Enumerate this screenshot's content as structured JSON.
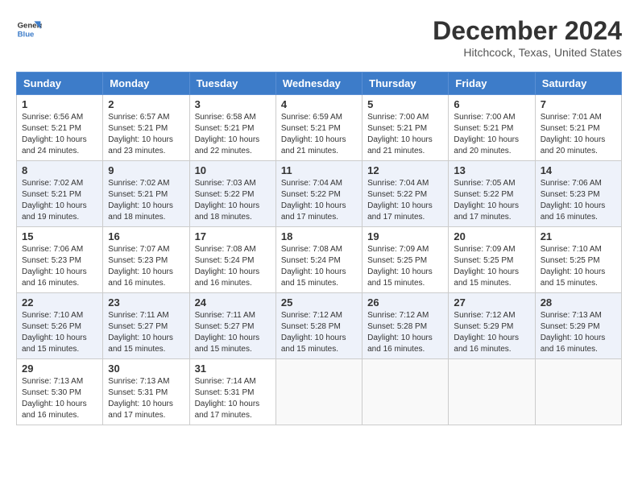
{
  "header": {
    "logo_line1": "General",
    "logo_line2": "Blue",
    "month": "December 2024",
    "location": "Hitchcock, Texas, United States"
  },
  "days_of_week": [
    "Sunday",
    "Monday",
    "Tuesday",
    "Wednesday",
    "Thursday",
    "Friday",
    "Saturday"
  ],
  "weeks": [
    [
      {
        "day": "1",
        "sunrise": "6:56 AM",
        "sunset": "5:21 PM",
        "daylight": "10 hours and 24 minutes."
      },
      {
        "day": "2",
        "sunrise": "6:57 AM",
        "sunset": "5:21 PM",
        "daylight": "10 hours and 23 minutes."
      },
      {
        "day": "3",
        "sunrise": "6:58 AM",
        "sunset": "5:21 PM",
        "daylight": "10 hours and 22 minutes."
      },
      {
        "day": "4",
        "sunrise": "6:59 AM",
        "sunset": "5:21 PM",
        "daylight": "10 hours and 21 minutes."
      },
      {
        "day": "5",
        "sunrise": "7:00 AM",
        "sunset": "5:21 PM",
        "daylight": "10 hours and 21 minutes."
      },
      {
        "day": "6",
        "sunrise": "7:00 AM",
        "sunset": "5:21 PM",
        "daylight": "10 hours and 20 minutes."
      },
      {
        "day": "7",
        "sunrise": "7:01 AM",
        "sunset": "5:21 PM",
        "daylight": "10 hours and 20 minutes."
      }
    ],
    [
      {
        "day": "8",
        "sunrise": "7:02 AM",
        "sunset": "5:21 PM",
        "daylight": "10 hours and 19 minutes."
      },
      {
        "day": "9",
        "sunrise": "7:02 AM",
        "sunset": "5:21 PM",
        "daylight": "10 hours and 18 minutes."
      },
      {
        "day": "10",
        "sunrise": "7:03 AM",
        "sunset": "5:22 PM",
        "daylight": "10 hours and 18 minutes."
      },
      {
        "day": "11",
        "sunrise": "7:04 AM",
        "sunset": "5:22 PM",
        "daylight": "10 hours and 17 minutes."
      },
      {
        "day": "12",
        "sunrise": "7:04 AM",
        "sunset": "5:22 PM",
        "daylight": "10 hours and 17 minutes."
      },
      {
        "day": "13",
        "sunrise": "7:05 AM",
        "sunset": "5:22 PM",
        "daylight": "10 hours and 17 minutes."
      },
      {
        "day": "14",
        "sunrise": "7:06 AM",
        "sunset": "5:23 PM",
        "daylight": "10 hours and 16 minutes."
      }
    ],
    [
      {
        "day": "15",
        "sunrise": "7:06 AM",
        "sunset": "5:23 PM",
        "daylight": "10 hours and 16 minutes."
      },
      {
        "day": "16",
        "sunrise": "7:07 AM",
        "sunset": "5:23 PM",
        "daylight": "10 hours and 16 minutes."
      },
      {
        "day": "17",
        "sunrise": "7:08 AM",
        "sunset": "5:24 PM",
        "daylight": "10 hours and 16 minutes."
      },
      {
        "day": "18",
        "sunrise": "7:08 AM",
        "sunset": "5:24 PM",
        "daylight": "10 hours and 15 minutes."
      },
      {
        "day": "19",
        "sunrise": "7:09 AM",
        "sunset": "5:25 PM",
        "daylight": "10 hours and 15 minutes."
      },
      {
        "day": "20",
        "sunrise": "7:09 AM",
        "sunset": "5:25 PM",
        "daylight": "10 hours and 15 minutes."
      },
      {
        "day": "21",
        "sunrise": "7:10 AM",
        "sunset": "5:25 PM",
        "daylight": "10 hours and 15 minutes."
      }
    ],
    [
      {
        "day": "22",
        "sunrise": "7:10 AM",
        "sunset": "5:26 PM",
        "daylight": "10 hours and 15 minutes."
      },
      {
        "day": "23",
        "sunrise": "7:11 AM",
        "sunset": "5:27 PM",
        "daylight": "10 hours and 15 minutes."
      },
      {
        "day": "24",
        "sunrise": "7:11 AM",
        "sunset": "5:27 PM",
        "daylight": "10 hours and 15 minutes."
      },
      {
        "day": "25",
        "sunrise": "7:12 AM",
        "sunset": "5:28 PM",
        "daylight": "10 hours and 15 minutes."
      },
      {
        "day": "26",
        "sunrise": "7:12 AM",
        "sunset": "5:28 PM",
        "daylight": "10 hours and 16 minutes."
      },
      {
        "day": "27",
        "sunrise": "7:12 AM",
        "sunset": "5:29 PM",
        "daylight": "10 hours and 16 minutes."
      },
      {
        "day": "28",
        "sunrise": "7:13 AM",
        "sunset": "5:29 PM",
        "daylight": "10 hours and 16 minutes."
      }
    ],
    [
      {
        "day": "29",
        "sunrise": "7:13 AM",
        "sunset": "5:30 PM",
        "daylight": "10 hours and 16 minutes."
      },
      {
        "day": "30",
        "sunrise": "7:13 AM",
        "sunset": "5:31 PM",
        "daylight": "10 hours and 17 minutes."
      },
      {
        "day": "31",
        "sunrise": "7:14 AM",
        "sunset": "5:31 PM",
        "daylight": "10 hours and 17 minutes."
      },
      null,
      null,
      null,
      null
    ]
  ]
}
